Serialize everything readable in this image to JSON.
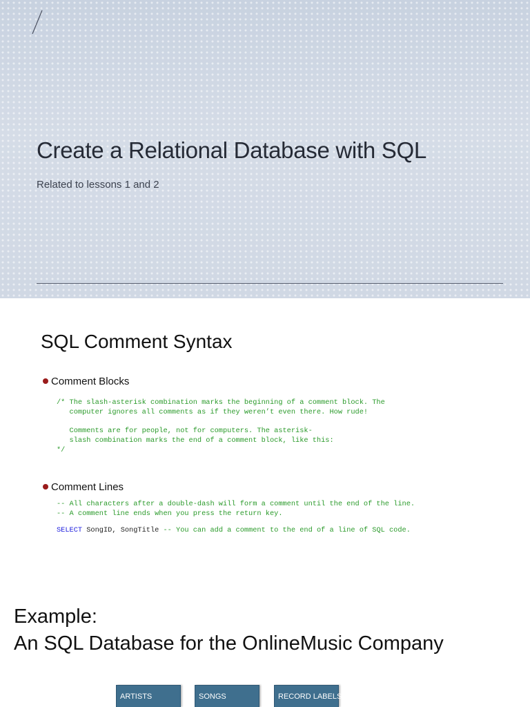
{
  "slide1": {
    "title": "Create a Relational Database with SQL",
    "subtitle": "Related to lessons 1 and 2"
  },
  "slide2": {
    "heading": "SQL Comment Syntax",
    "bullets": [
      {
        "label": "Comment Blocks",
        "code_lines": [
          "/* The slash-asterisk combination marks the beginning of a comment block. The",
          "   computer ignores all comments as if they weren’t even there. How rude!",
          "",
          "   Comments are for people, not for computers. The asterisk-",
          "   slash combination marks the end of a comment block, like this:",
          "*/"
        ]
      },
      {
        "label": "Comment Lines",
        "code_lines": [
          "-- All characters after a double-dash will form a comment until the end of the line.",
          "-- A comment line ends when you press the return key."
        ],
        "sql_example": {
          "keyword": "SELECT",
          "identifiers": " SongID, SongTitle",
          "comment": " -- You can add a comment to the end of a line of SQL code."
        }
      }
    ]
  },
  "slide3": {
    "title_line1": "Example:",
    "title_line2": "An SQL Database for the OnlineMusic Company",
    "tabs": [
      "ARTISTS",
      "SONGS",
      "RECORD LABELS"
    ]
  },
  "colors": {
    "code_comment": "#2a9a2a",
    "code_keyword": "#1a1add",
    "bullet": "#9a1b1b",
    "tab_bg": "#3f6f8e"
  }
}
